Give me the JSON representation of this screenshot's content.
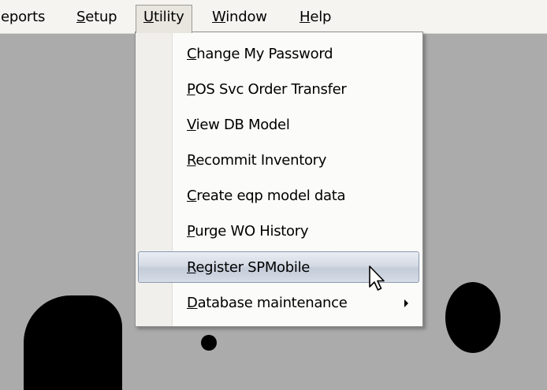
{
  "menubar": {
    "items": [
      {
        "label": "eports",
        "mnemonic": ""
      },
      {
        "label": "etup",
        "mnemonic": "S"
      },
      {
        "label": "tility",
        "mnemonic": "U"
      },
      {
        "label": "indow",
        "mnemonic": "W"
      },
      {
        "label": "elp",
        "mnemonic": "H"
      }
    ]
  },
  "utility_menu": {
    "items": [
      {
        "mnemonic": "C",
        "rest": "hange My Password"
      },
      {
        "mnemonic": "P",
        "rest": "OS Svc Order Transfer"
      },
      {
        "mnemonic": "V",
        "rest": "iew DB Model"
      },
      {
        "mnemonic": "R",
        "rest": "ecommit Inventory"
      },
      {
        "mnemonic": "C",
        "rest": "reate eqp model data"
      },
      {
        "mnemonic": "P",
        "rest": "urge WO History"
      },
      {
        "mnemonic": "R",
        "rest": "egister SPMobile"
      },
      {
        "mnemonic": "D",
        "rest": "atabase maintenance"
      }
    ],
    "highlighted_index": 6
  },
  "colors": {
    "desktop": "#ababab",
    "menubar": "#f5f4f1",
    "highlight": "#c4ccd9"
  },
  "icons": [
    "submenu-arrow-icon",
    "mouse-pointer-icon"
  ]
}
